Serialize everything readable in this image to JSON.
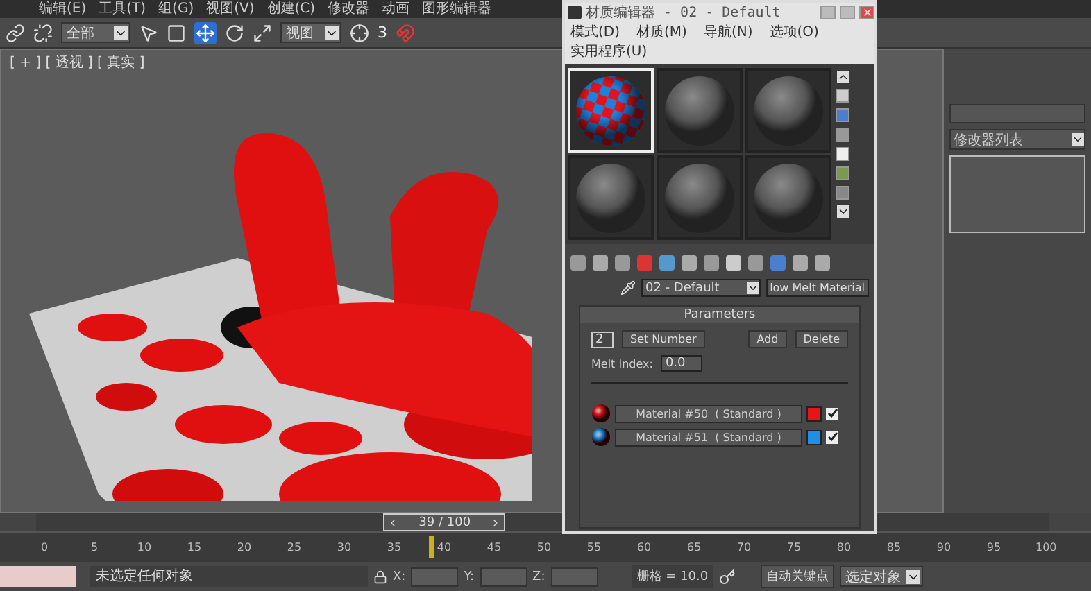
{
  "menu_bar": [
    "编辑(E)",
    "工具(T)",
    "组(G)",
    "视图(V)",
    "创建(C)",
    "修改器",
    "动画",
    "图形编辑器"
  ],
  "toolbar": {
    "selection_filter": "全部",
    "reference_coord": "视图",
    "snap": "3"
  },
  "viewport": {
    "label": "[ + ] [ 透视 ] [ 真实 ]"
  },
  "material_editor": {
    "title": "材质编辑器 - 02 - Default",
    "menus": [
      "模式(D)",
      "材质(M)",
      "导航(N)",
      "选项(O)",
      "实用程序(U)"
    ],
    "slots": [
      {
        "kind": "checker",
        "selected": true
      },
      {
        "kind": "plain",
        "selected": false
      },
      {
        "kind": "plain",
        "selected": false
      },
      {
        "kind": "plain",
        "selected": false
      },
      {
        "kind": "plain",
        "selected": false
      },
      {
        "kind": "plain",
        "selected": false
      }
    ],
    "material_name": "02 - Default",
    "type_button": "low Melt Material",
    "parameters": {
      "title": "Parameters",
      "count": "2",
      "set_number": "Set Number",
      "add": "Add",
      "delete": "Delete",
      "melt_index_label": "Melt Index:",
      "melt_index": "0.0",
      "materials": [
        {
          "name": "Material #50  ( Standard )",
          "color": "#e8141a",
          "checked": true
        },
        {
          "name": "Material #51  ( Standard )",
          "color": "#1e8fe8",
          "checked": true
        }
      ]
    }
  },
  "command_panel": {
    "modifier_list": "修改器列表"
  },
  "time_slider": {
    "reading": "39 / 100",
    "level": 0.39
  },
  "ruler_ticks": [
    "0",
    "5",
    "10",
    "15",
    "20",
    "25",
    "30",
    "35",
    "40",
    "45",
    "50",
    "55",
    "60",
    "65",
    "70",
    "75",
    "80",
    "85",
    "90",
    "95",
    "100"
  ],
  "status_bar": {
    "prompt": "未选定任何对象",
    "x_label": "X:",
    "y_label": "Y:",
    "z_label": "Z:",
    "grid": "栅格 = 10.0",
    "auto_key": "自动关键点",
    "key_filter": "选定对象"
  }
}
